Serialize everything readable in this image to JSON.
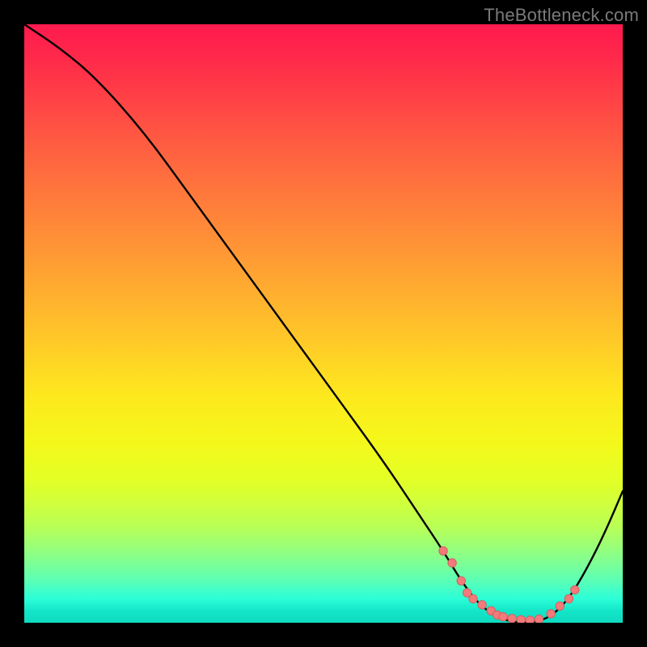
{
  "watermark": "TheBottleneck.com",
  "colors": {
    "background": "#000000",
    "curve": "#000000",
    "marker_fill": "#f27a7a",
    "marker_stroke": "#d46060",
    "watermark": "#7a7a7a"
  },
  "chart_data": {
    "type": "line",
    "title": "",
    "xlabel": "",
    "ylabel": "",
    "xlim": [
      0,
      100
    ],
    "ylim": [
      0,
      100
    ],
    "grid": false,
    "legend": false,
    "series": [
      {
        "name": "bottleneck-curve",
        "x": [
          0,
          6,
          12,
          20,
          28,
          36,
          44,
          52,
          60,
          66,
          70,
          73,
          76,
          79,
          82,
          85,
          88,
          91,
          94,
          97,
          100
        ],
        "y": [
          100,
          96,
          91,
          82,
          71,
          60,
          49,
          38,
          27,
          18,
          12,
          7,
          3,
          1,
          0,
          0,
          1,
          4,
          9,
          15,
          22
        ]
      }
    ],
    "markers": {
      "name": "highlighted-points",
      "x": [
        70,
        71.5,
        73,
        74,
        75,
        76.5,
        78,
        79,
        80,
        81.5,
        83,
        84.5,
        86,
        88,
        89.5,
        91,
        92
      ],
      "y": [
        12,
        10,
        7,
        5,
        4,
        3,
        2,
        1.3,
        1,
        0.7,
        0.5,
        0.4,
        0.6,
        1.5,
        2.8,
        4,
        5.5
      ]
    },
    "background_gradient": {
      "direction": "top-to-bottom",
      "stops": [
        {
          "pos": 0.0,
          "color": "#ff1a4e"
        },
        {
          "pos": 0.3,
          "color": "#ff8a38"
        },
        {
          "pos": 0.6,
          "color": "#fde81e"
        },
        {
          "pos": 0.85,
          "color": "#9cff75"
        },
        {
          "pos": 1.0,
          "color": "#0fdac0"
        }
      ]
    }
  }
}
